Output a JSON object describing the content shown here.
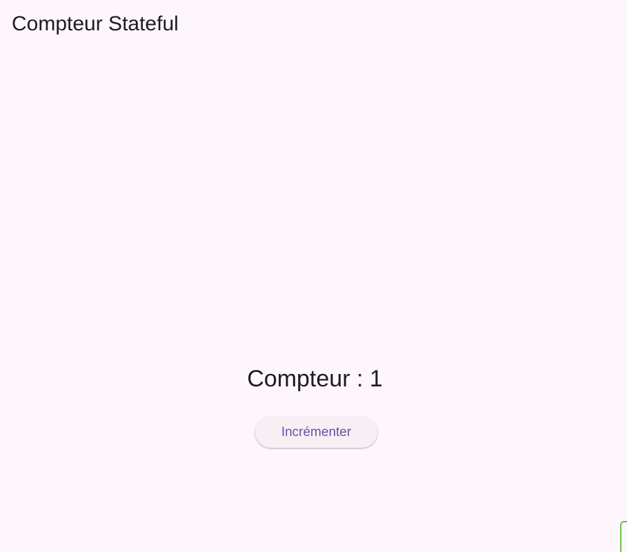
{
  "app_bar": {
    "title": "Compteur Stateful"
  },
  "main": {
    "counter_label": "Compteur : 1",
    "increment_button_label": "Incrémenter"
  },
  "colors": {
    "background": "#fdf7fd",
    "text": "#1f1b20",
    "button_background": "#f6f0f5",
    "button_text": "#6750a4",
    "corner_accent": "#6cc24a"
  }
}
